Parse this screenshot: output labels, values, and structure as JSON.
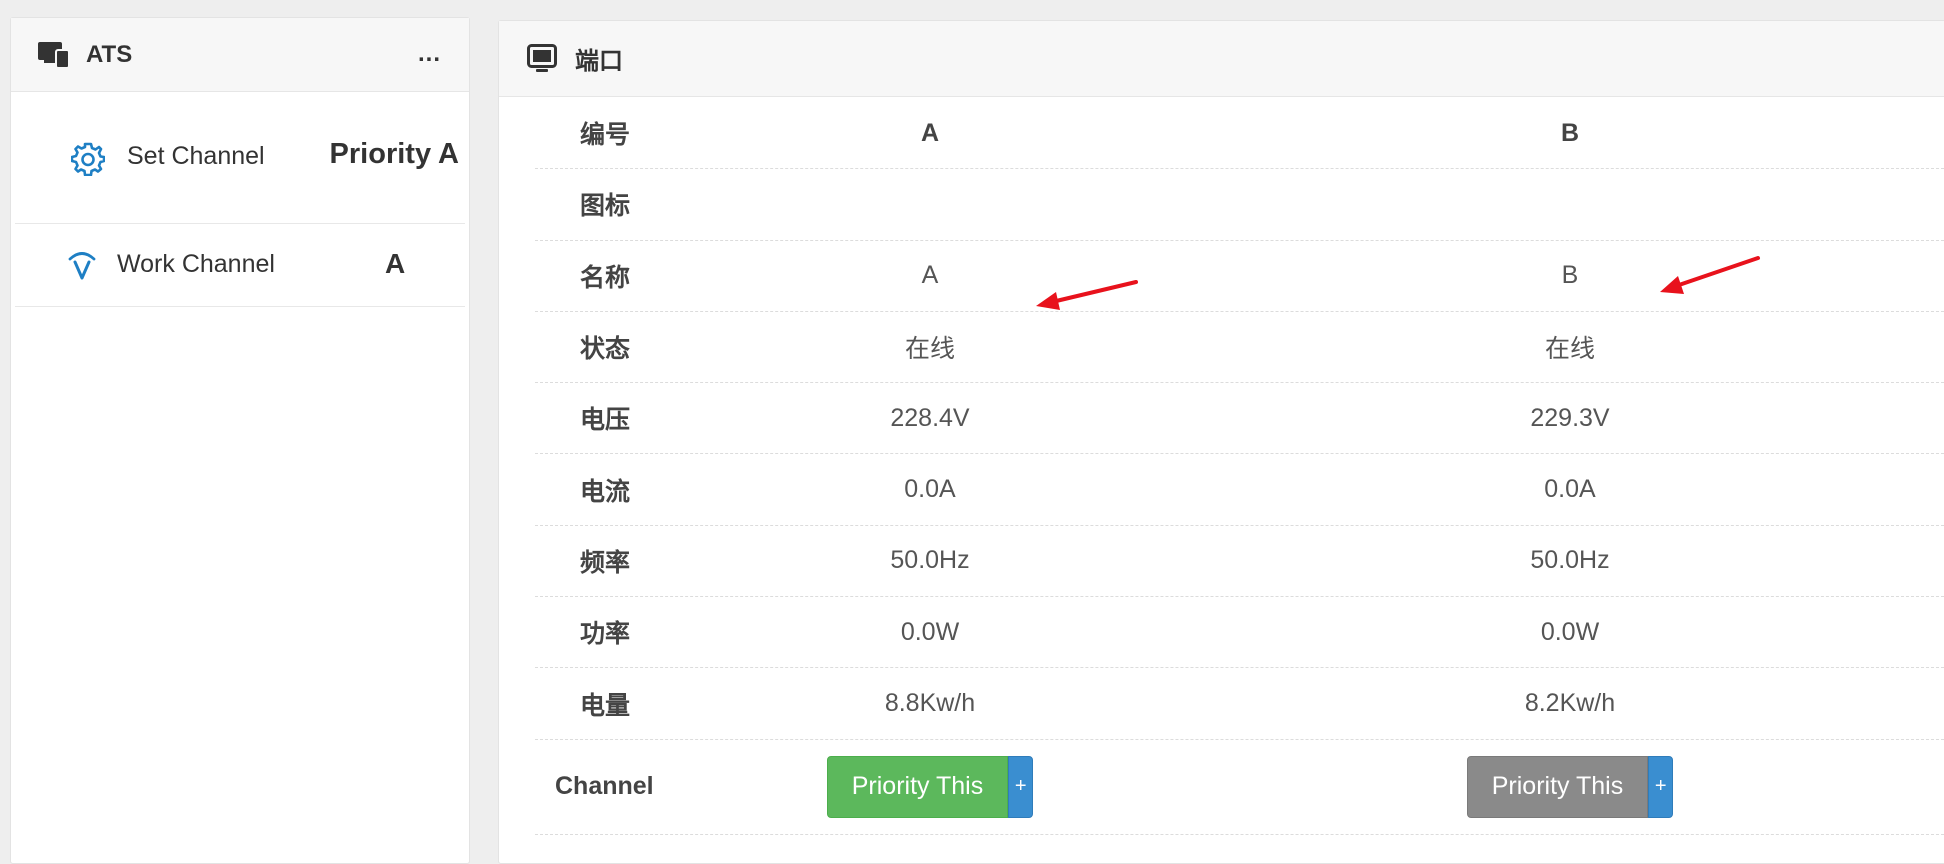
{
  "left_panel": {
    "title": "ATS",
    "more": "...",
    "set_channel": {
      "label": "Set Channel",
      "value": "Priority A"
    },
    "work_channel": {
      "label": "Work Channel",
      "value": "A"
    }
  },
  "right_panel": {
    "title": "端口",
    "rows": [
      {
        "label": "编号",
        "a": "A",
        "b": "B"
      },
      {
        "label": "图标",
        "a": "",
        "b": ""
      },
      {
        "label": "名称",
        "a": "A",
        "b": "B"
      },
      {
        "label": "状态",
        "a": "在线",
        "b": "在线"
      },
      {
        "label": "电压",
        "a": "228.4V",
        "b": "229.3V"
      },
      {
        "label": "电流",
        "a": "0.0A",
        "b": "0.0A"
      },
      {
        "label": "频率",
        "a": "50.0Hz",
        "b": "50.0Hz"
      },
      {
        "label": "功率",
        "a": "0.0W",
        "b": "0.0W"
      },
      {
        "label": "电量",
        "a": "8.8Kw/h",
        "b": "8.2Kw/h"
      }
    ],
    "channel_row": {
      "label": "Channel",
      "a_button": "Priority This",
      "b_button": "Priority This",
      "plus": "+"
    }
  },
  "colors": {
    "green_button": "#5cb85c",
    "gray_button": "#8a8a8a",
    "plus_button": "#3a8ed0",
    "icon_blue": "#1e7fc4",
    "arrow_red": "#e8121c"
  }
}
